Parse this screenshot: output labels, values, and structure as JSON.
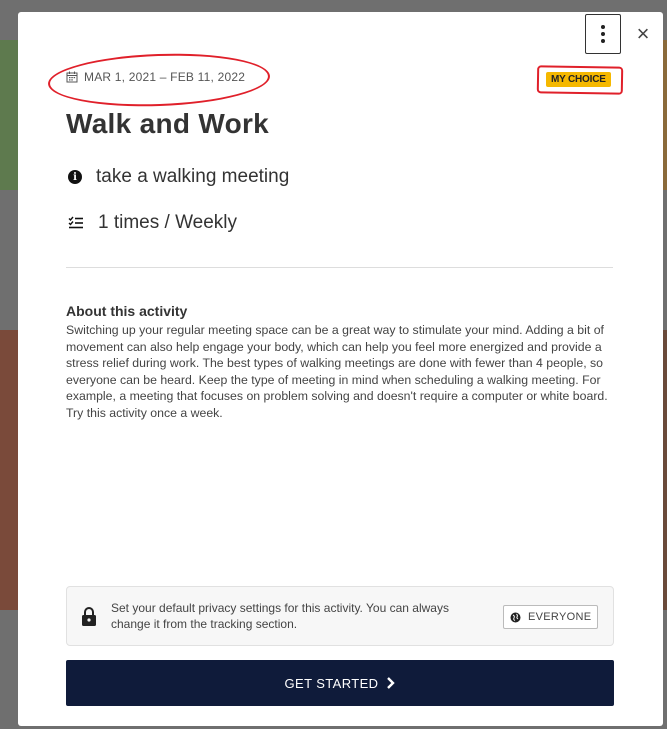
{
  "modal": {
    "menu_icon": "kebab-vertical-icon",
    "close_glyph": "×",
    "date_range": "MAR 1, 2021 – FEB 11, 2022",
    "badge": "MY CHOICE",
    "title": "Walk and Work",
    "tip": "take a walking meeting",
    "frequency": "1 times / Weekly",
    "about_heading": "About this activity",
    "about_text": "Switching up your regular meeting space can be a great way to stimulate your mind. Adding a bit of movement can also help engage your body, which can help you feel more energized and provide a stress relief during work. The best types of walking meetings are done with fewer than 4 people, so everyone can be heard. Keep the type of meeting in mind when scheduling a walking meeting. For example, a meeting that focuses on problem solving and doesn't require a computer or white board. Try this activity once a week.",
    "privacy_text": "Set your default privacy settings for this activity. You can always change it from the tracking section.",
    "privacy_setting": "EVERYONE",
    "cta_label": "GET STARTED"
  },
  "colors": {
    "cta_bg": "#0f1b3a",
    "badge_bg": "#f5b800",
    "annotation": "#e0202a"
  }
}
